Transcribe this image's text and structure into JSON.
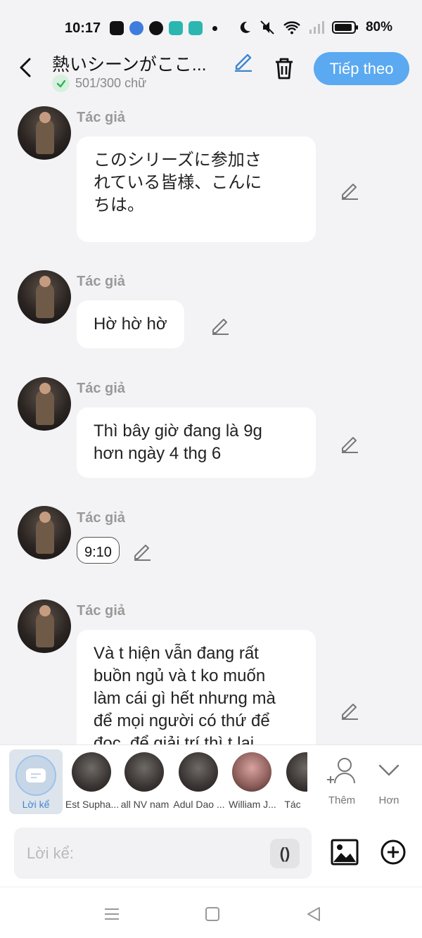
{
  "status_bar": {
    "time": "10:17",
    "battery": "80%"
  },
  "header": {
    "title": "熱いシーンがここ...",
    "word_count": "501/300 chữ",
    "next_label": "Tiếp theo"
  },
  "messages": [
    {
      "author": "Tác giả",
      "text": "このシリーズに参加さ\nれている皆様、こんに\nちは。"
    },
    {
      "author": "Tác giả",
      "text": "Hờ hờ hờ"
    },
    {
      "author": "Tác giả",
      "text": "Thì bây giờ đang là 9g\nhơn ngày 4 thg 6"
    },
    {
      "author": "Tác giả",
      "text": "9:10"
    },
    {
      "author": "Tác giả",
      "text": "Và t hiện vẫn đang rất\nbuồn ngủ và t ko muốn\nlàm cái gì hết nhưng mà\nđể mọi người có thứ để\nđọc, để giải trí thì t lại"
    }
  ],
  "characters": {
    "narrator_label": "Lời kể",
    "items": [
      {
        "label": "Est Supha..."
      },
      {
        "label": "all NV nam"
      },
      {
        "label": "Adul Dao ..."
      },
      {
        "label": "William J..."
      },
      {
        "label": "Tác"
      }
    ],
    "more_label": "Thêm",
    "hon_label": "Hơn"
  },
  "input": {
    "placeholder": "Lời kể:",
    "paren_label": "()"
  }
}
